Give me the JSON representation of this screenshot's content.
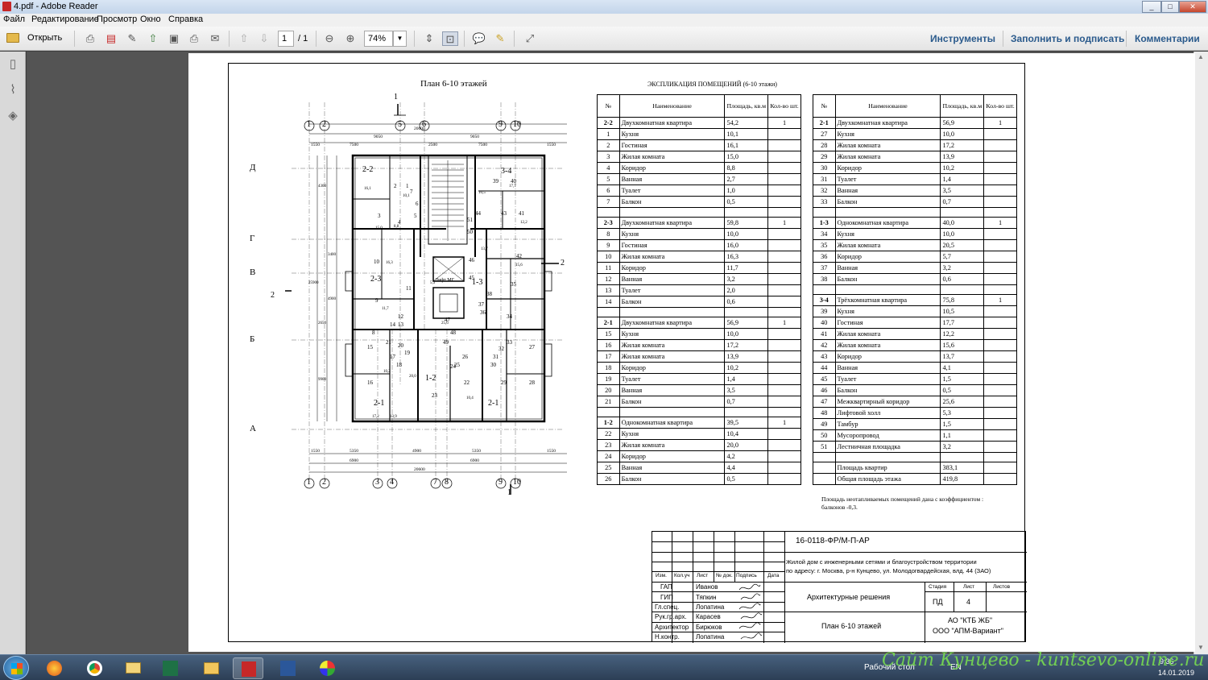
{
  "window": {
    "title": "4.pdf - Adobe Reader",
    "min_label": "_",
    "max_label": "□",
    "close_label": "✕"
  },
  "menu": [
    "Файл",
    "Редактирование",
    "Просмотр",
    "Окно",
    "Справка"
  ],
  "toolbar": {
    "open_label": "Открыть",
    "page_current": "1",
    "page_total": "/ 1",
    "zoom": "74%",
    "tools_link": "Инструменты",
    "fill_sign_link": "Заполнить и подписать",
    "comments_link": "Комментарии"
  },
  "drawing": {
    "plan_title": "План 6-10 этажей",
    "dims_top": [
      "20600",
      "9050",
      "9050",
      "1550",
      "7500",
      "2500",
      "7500",
      "1550"
    ],
    "dims_bottom": [
      "1550",
      "5350",
      "4900",
      "5350",
      "1550",
      "6900",
      "6900",
      "20600"
    ],
    "dims_left": [
      "4300",
      "3400",
      "4900",
      "2650",
      "9900",
      "25900"
    ],
    "axes_top": [
      "1",
      "2",
      "5",
      "6",
      "9",
      "10"
    ],
    "axes_bottom": [
      "1",
      "2",
      "3",
      "4",
      "7",
      "8",
      "9",
      "10"
    ],
    "axes_left": [
      "Д",
      "Г",
      "В",
      "Б",
      "А"
    ],
    "section_marks": [
      "1",
      "1",
      "2",
      "2"
    ],
    "apt_labels": [
      "2-2",
      "3-4",
      "2-3",
      "1-3",
      "1-2",
      "2-1",
      "2-1"
    ],
    "room_numbers": [
      "1",
      "2",
      "3",
      "4",
      "5",
      "6",
      "7",
      "8",
      "9",
      "10",
      "11",
      "12",
      "13",
      "14",
      "15",
      "16",
      "17",
      "18",
      "19",
      "20",
      "21",
      "22",
      "23",
      "24",
      "25",
      "26",
      "27",
      "28",
      "29",
      "30",
      "31",
      "32",
      "33",
      "34",
      "35",
      "36",
      "37",
      "38",
      "39",
      "40",
      "41",
      "42",
      "43",
      "44",
      "45",
      "46",
      "47",
      "48",
      "49",
      "50",
      "51"
    ],
    "room_areas": [
      "10,1",
      "8,8",
      "15,0",
      "16,1",
      "16,3",
      "11,7",
      "20,0",
      "17,2",
      "13,9",
      "10,2",
      "10,4",
      "25,6",
      "5,3",
      "17,7",
      "12,2",
      "15,6",
      "13,7",
      "10,5"
    ],
    "lift_label": "Лифт МГ"
  },
  "explication": {
    "title": "ЭКСПЛИКАЦИЯ ПОМЕЩЕНИЙ (6-10 этажи)",
    "headers": [
      "№",
      "Наименование",
      "Площадь, кв.м",
      "Кол-во шт."
    ],
    "left": [
      [
        "2-2",
        "Двухкомнатная квартира",
        "54,2",
        "1"
      ],
      [
        "1",
        "Кухня",
        "10,1",
        ""
      ],
      [
        "2",
        "Гостиная",
        "16,1",
        ""
      ],
      [
        "3",
        "Жилая комната",
        "15,0",
        ""
      ],
      [
        "4",
        "Коридор",
        "8,8",
        ""
      ],
      [
        "5",
        "Ванная",
        "2,7",
        ""
      ],
      [
        "6",
        "Туалет",
        "1,0",
        ""
      ],
      [
        "7",
        "Балкон",
        "0,5",
        ""
      ],
      [
        "",
        "",
        "",
        ""
      ],
      [
        "2-3",
        "Двухкомнатная квартира",
        "59,8",
        "1"
      ],
      [
        "8",
        "Кухня",
        "10,0",
        ""
      ],
      [
        "9",
        "Гостиная",
        "16,0",
        ""
      ],
      [
        "10",
        "Жилая комната",
        "16,3",
        ""
      ],
      [
        "11",
        "Коридор",
        "11,7",
        ""
      ],
      [
        "12",
        "Ванная",
        "3,2",
        ""
      ],
      [
        "13",
        "Туалет",
        "2,0",
        ""
      ],
      [
        "14",
        "Балкон",
        "0,6",
        ""
      ],
      [
        "",
        "",
        "",
        ""
      ],
      [
        "2-1",
        "Двухкомнатная квартира",
        "56,9",
        "1"
      ],
      [
        "15",
        "Кухня",
        "10,0",
        ""
      ],
      [
        "16",
        "Жилая комната",
        "17,2",
        ""
      ],
      [
        "17",
        "Жилая комната",
        "13,9",
        ""
      ],
      [
        "18",
        "Коридор",
        "10,2",
        ""
      ],
      [
        "19",
        "Туалет",
        "1,4",
        ""
      ],
      [
        "20",
        "Ванная",
        "3,5",
        ""
      ],
      [
        "21",
        "Балкон",
        "0,7",
        ""
      ],
      [
        "",
        "",
        "",
        ""
      ],
      [
        "1-2",
        "Однокомнатная квартира",
        "39,5",
        "1"
      ],
      [
        "22",
        "Кухня",
        "10,4",
        ""
      ],
      [
        "23",
        "Жилая комната",
        "20,0",
        ""
      ],
      [
        "24",
        "Коридор",
        "4,2",
        ""
      ],
      [
        "25",
        "Ванная",
        "4,4",
        ""
      ],
      [
        "26",
        "Балкон",
        "0,5",
        ""
      ]
    ],
    "right": [
      [
        "2-1",
        "Двухкомнатная квартира",
        "56,9",
        "1"
      ],
      [
        "27",
        "Кухня",
        "10,0",
        ""
      ],
      [
        "28",
        "Жилая комната",
        "17,2",
        ""
      ],
      [
        "29",
        "Жилая комната",
        "13,9",
        ""
      ],
      [
        "30",
        "Коридор",
        "10,2",
        ""
      ],
      [
        "31",
        "Туалет",
        "1,4",
        ""
      ],
      [
        "32",
        "Ванная",
        "3,5",
        ""
      ],
      [
        "33",
        "Балкон",
        "0,7",
        ""
      ],
      [
        "",
        "",
        "",
        ""
      ],
      [
        "1-3",
        "Однокомнатная квартира",
        "40,0",
        "1"
      ],
      [
        "34",
        "Кухня",
        "10,0",
        ""
      ],
      [
        "35",
        "Жилая комната",
        "20,5",
        ""
      ],
      [
        "36",
        "Коридор",
        "5,7",
        ""
      ],
      [
        "37",
        "Ванная",
        "3,2",
        ""
      ],
      [
        "38",
        "Балкон",
        "0,6",
        ""
      ],
      [
        "",
        "",
        "",
        ""
      ],
      [
        "3-4",
        "Трёхкомнатная квартира",
        "75,8",
        "1"
      ],
      [
        "39",
        "Кухня",
        "10,5",
        ""
      ],
      [
        "40",
        "Гостиная",
        "17,7",
        ""
      ],
      [
        "41",
        "Жилая комната",
        "12,2",
        ""
      ],
      [
        "42",
        "Жилая комната",
        "15,6",
        ""
      ],
      [
        "43",
        "Коридор",
        "13,7",
        ""
      ],
      [
        "44",
        "Ванная",
        "4,1",
        ""
      ],
      [
        "45",
        "Туалет",
        "1,5",
        ""
      ],
      [
        "46",
        "Балкон",
        "0,5",
        ""
      ],
      [
        "47",
        "Межквартирный коридор",
        "25,6",
        ""
      ],
      [
        "48",
        "Лифтовой холл",
        "5,3",
        ""
      ],
      [
        "49",
        "Тамбур",
        "1,5",
        ""
      ],
      [
        "50",
        "Мусоропровод",
        "1,1",
        ""
      ],
      [
        "51",
        "Лестничная площадка",
        "3,2",
        ""
      ],
      [
        "",
        "",
        "",
        ""
      ],
      [
        "",
        "Площадь квартир",
        "383,1",
        ""
      ],
      [
        "",
        "Общая площадь этажа",
        "419,8",
        ""
      ]
    ],
    "note_line1": "Площадь неотапливаемых помещений дана с коэффициентом :",
    "note_line2": "балконов -0,3."
  },
  "stamp": {
    "code": "16-0118-ФР/М-П-АР",
    "project_line1": "Жилой дом с инженерными сетями и благоустройством территории",
    "project_line2": "по адресу: г. Москва, р-н Кунцево, ул. Молодогвардейская, влд. 44 (ЗАО)",
    "col_headers": [
      "Изм.",
      "Кол.уч",
      "Лист",
      "№ док.",
      "Подпись",
      "Дата"
    ],
    "people": [
      [
        "ГАП",
        "Иванов"
      ],
      [
        "ГИП",
        "Тяпкин"
      ],
      [
        "Гл.спец.",
        "Лопатина"
      ],
      [
        "Рук.гр.арх.",
        "Карасев"
      ],
      [
        "Архитектор",
        "Бирюков"
      ],
      [
        "Н.контр.",
        "Лопатина"
      ]
    ],
    "section": "Архитектурные решения",
    "stage_header": "Стадия",
    "sheet_header": "Лист",
    "sheets_header": "Листов",
    "stage": "ПД",
    "sheet": "4",
    "sheets": "",
    "drawing_name": "План 6-10 этажей",
    "org1": "АО \"КТБ ЖБ\"",
    "org2": "ООО \"АПМ-Вариант\""
  },
  "taskbar": {
    "desktop_label": "Рабочий стол",
    "lang": "EN",
    "time": "9:36",
    "date": "14.01.2019",
    "watermark": "Сайт Кунцево - kuntsevo-online.ru"
  }
}
